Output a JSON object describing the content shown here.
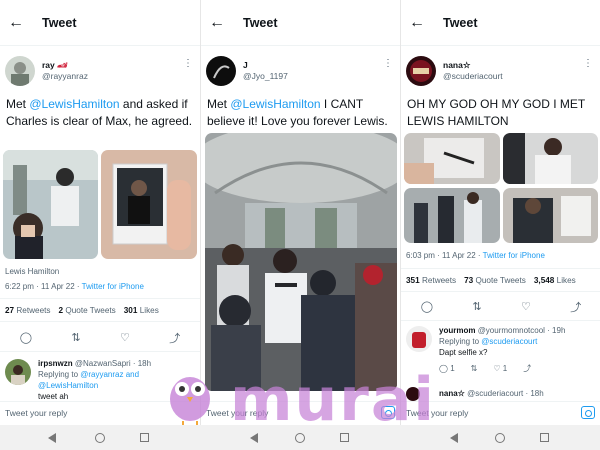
{
  "colors": {
    "accent": "#1d9bf0",
    "watermark": "#c682d7"
  },
  "panels": [
    {
      "header_title": "Tweet",
      "user": {
        "display_name": "ray",
        "handle": "@rayyanraz"
      },
      "text_pre": "Met ",
      "mention": "@LewisHamilton",
      "text_post": " and asked if Charles is clear of Max, he agreed.",
      "photo_caption": "Lewis Hamilton",
      "time": "6:22 pm · 11 Apr 22 · ",
      "source": "Twitter for iPhone",
      "stats": [
        {
          "count": "27",
          "label": "Retweets"
        },
        {
          "count": "2",
          "label": "Quote Tweets"
        },
        {
          "count": "301",
          "label": "Likes"
        }
      ],
      "reply": {
        "name": "irpsnwzn",
        "handle": "@NazwanSapri · 18h",
        "replying_to_label": "Replying to ",
        "replying_to": "@rayyanraz and @LewisHamilton",
        "body": "tweet ah"
      },
      "reply_placeholder": "Tweet your reply"
    },
    {
      "header_title": "Tweet",
      "user": {
        "display_name": "J",
        "handle": "@Jyo_1197"
      },
      "text_pre": "Met ",
      "mention": "@LewisHamilton",
      "text_post": " I CANT believe it! Love you forever Lewis.",
      "reply_placeholder": "Tweet your reply"
    },
    {
      "header_title": "Tweet",
      "user": {
        "display_name": "nana☆",
        "handle": "@scuderiacourt"
      },
      "text": "OH MY GOD OH MY GOD I MET LEWIS HAMILTON",
      "time": "6:03 pm · 11 Apr 22 · ",
      "source": "Twitter for iPhone",
      "stats": [
        {
          "count": "351",
          "label": "Retweets"
        },
        {
          "count": "73",
          "label": "Quote Tweets"
        },
        {
          "count": "3,548",
          "label": "Likes"
        }
      ],
      "reply": {
        "name": "yourmom",
        "handle": "@yourmomnotcool · 19h",
        "replying_to_label": "Replying to ",
        "replying_to": "@scuderiacourt",
        "body": "Dapt selfie x?",
        "reply_count": "1",
        "like_count": "1"
      },
      "next_reply": {
        "name": "nana☆",
        "handle": "@scuderiacourt · 18h"
      },
      "reply_placeholder": "Tweet your reply"
    }
  ],
  "watermark": "murai",
  "icons": {
    "back": "←",
    "more": "⋮",
    "reply": "◯",
    "retweet": "⇅",
    "like": "♡",
    "share": "⤴"
  }
}
